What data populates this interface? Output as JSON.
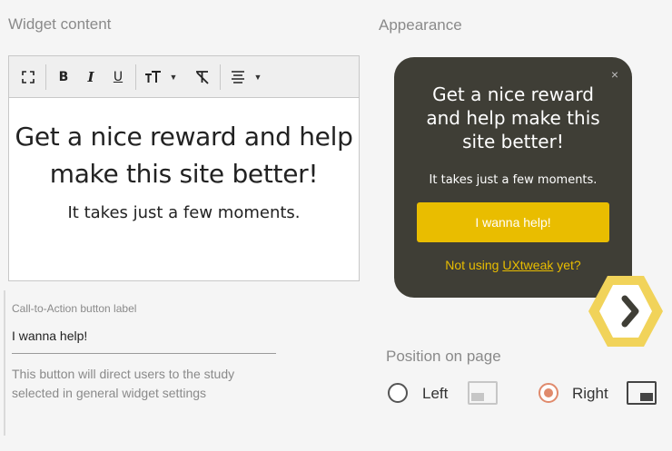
{
  "sections": {
    "widget_content": "Widget content",
    "appearance": "Appearance"
  },
  "toolbar": {
    "icons": [
      "fullscreen-icon",
      "bold-icon",
      "italic-icon",
      "underline-icon",
      "font-size-icon",
      "clear-format-icon",
      "align-center-icon"
    ],
    "bold": "B",
    "italic": "I",
    "underline": "U",
    "font_size": "тТ",
    "clear_format": "T̶"
  },
  "editor": {
    "heading": "Get a nice reward and help make this site better!",
    "subtext": "It takes just a few moments."
  },
  "cta": {
    "label": "Call-to-Action button label",
    "value": "I wanna help!",
    "help": "This button will direct users to the study selected in general widget settings"
  },
  "preview": {
    "close": "×",
    "heading": "Get a nice reward and help make this site better!",
    "subtext": "It takes just a few moments.",
    "button": "I wanna help!",
    "footer_prefix": "Not using ",
    "footer_link": "UXtweak",
    "footer_suffix": " yet?"
  },
  "position": {
    "title": "Position on page",
    "left_label": "Left",
    "right_label": "Right",
    "selected": "Right"
  },
  "colors": {
    "popup_bg": "#3f3e36",
    "accent": "#e9bd00",
    "radio_selected": "#e08a6c"
  }
}
